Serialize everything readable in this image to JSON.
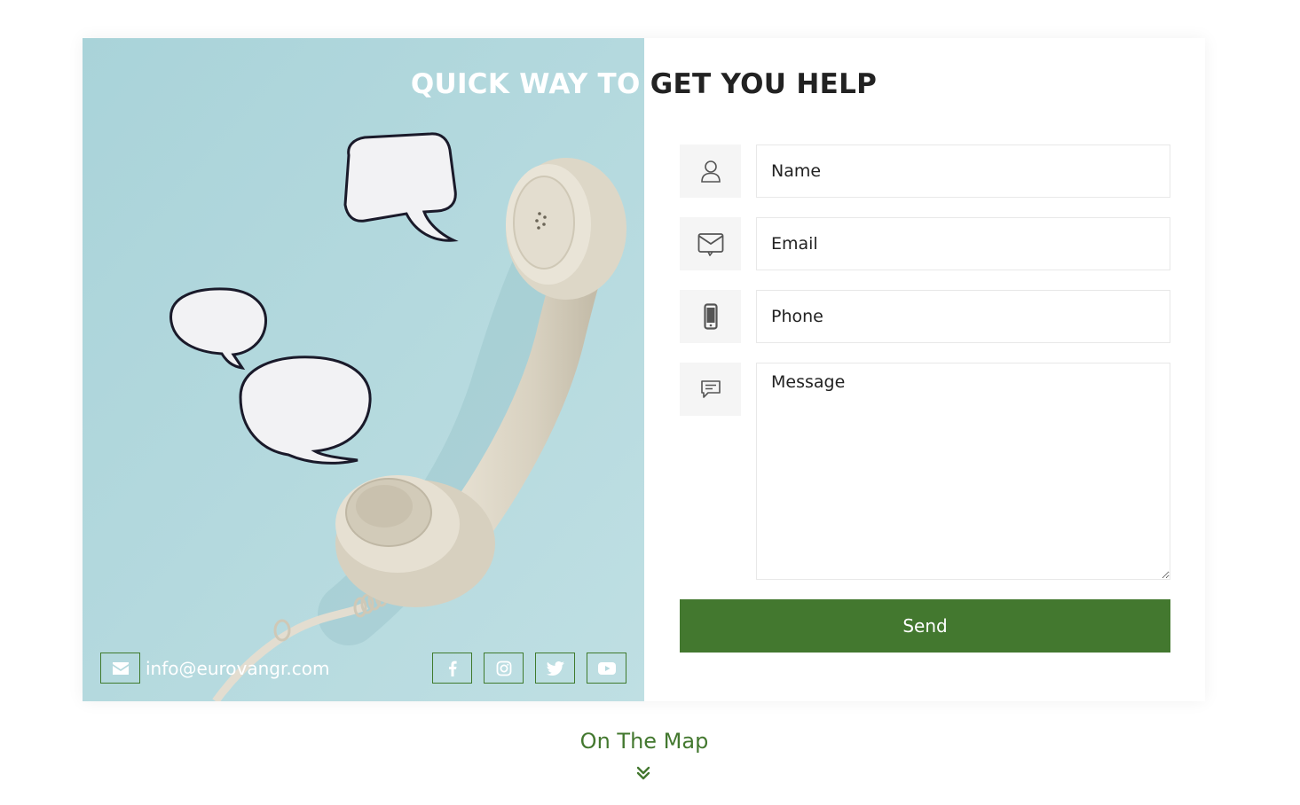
{
  "contact": {
    "title_part1": "QUICK WAY TO",
    "title_part2": "GET YOU HELP",
    "email": "info@eurovangr.com"
  },
  "form": {
    "name_placeholder": "Name",
    "email_placeholder": "Email",
    "phone_placeholder": "Phone",
    "message_placeholder": "Message",
    "send_label": "Send"
  },
  "social": [
    "facebook-icon",
    "instagram-icon",
    "twitter-icon",
    "youtube-icon"
  ],
  "map": {
    "title": "On The Map"
  },
  "colors": {
    "accent": "#43782f",
    "photo_bg": "#b4d9de",
    "icon_box_bg": "#f5f5f5"
  }
}
